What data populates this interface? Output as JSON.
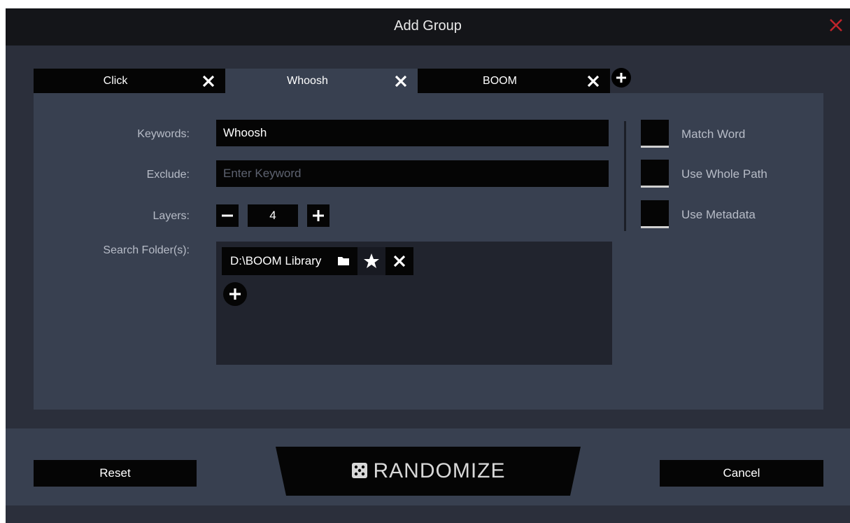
{
  "window": {
    "title": "Add Group"
  },
  "tabs": [
    {
      "label": "Click",
      "active": false
    },
    {
      "label": "Whoosh",
      "active": true
    },
    {
      "label": "BOOM",
      "active": false
    }
  ],
  "form": {
    "keywords_label": "Keywords:",
    "keywords_value": "Whoosh",
    "exclude_label": "Exclude:",
    "exclude_placeholder": "Enter Keyword",
    "layers_label": "Layers:",
    "layers_value": "4",
    "folders_label": "Search Folder(s):",
    "folder_path": "D:\\BOOM Library"
  },
  "options": [
    {
      "label": "Match Word",
      "checked": false
    },
    {
      "label": "Use Whole Path",
      "checked": false
    },
    {
      "label": "Use Metadata",
      "checked": false
    }
  ],
  "footer": {
    "reset_label": "Reset",
    "randomize_label": "RANDOMIZE",
    "cancel_label": "Cancel"
  },
  "colors": {
    "background": "#2b2f3b",
    "panel": "#384050",
    "field": "#050505",
    "close_accent": "#c0242b"
  },
  "icons": [
    "close-icon",
    "plus-icon",
    "minus-icon",
    "folder-icon",
    "star-icon",
    "dice-icon"
  ]
}
